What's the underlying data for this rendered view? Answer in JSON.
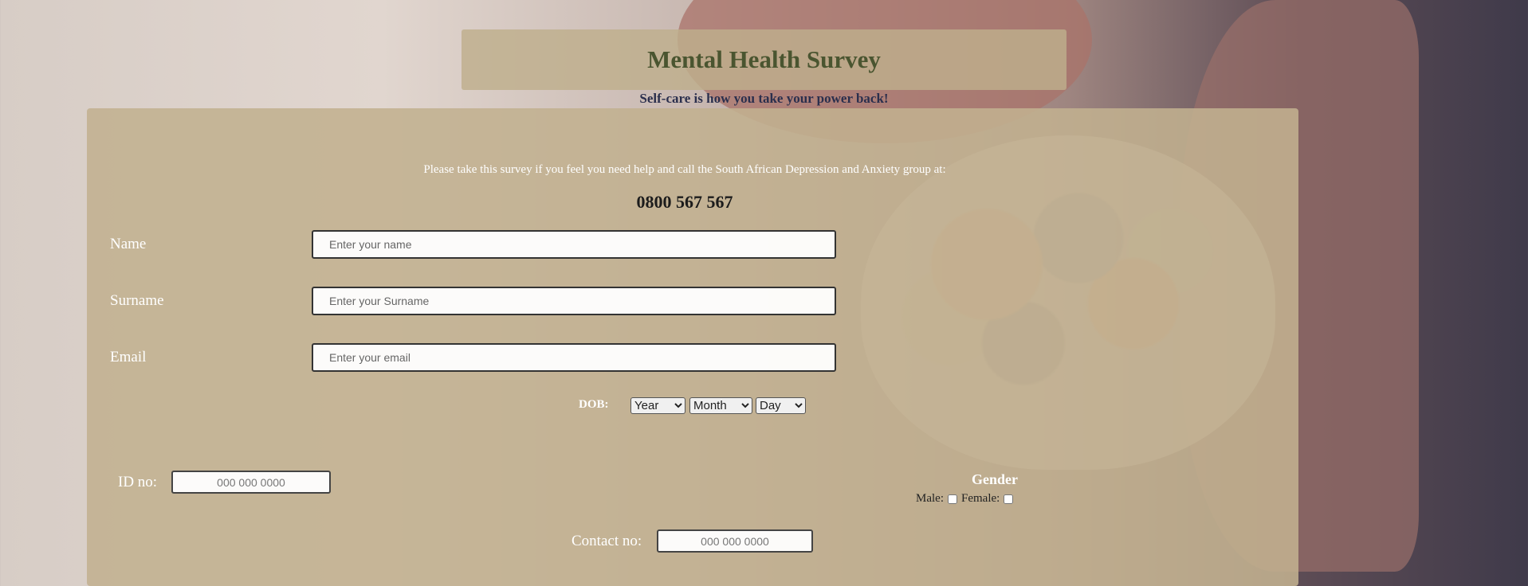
{
  "header": {
    "title": "Mental Health Survey",
    "tagline": "Self-care is how you take your power back!"
  },
  "intro": {
    "text": "Please take this survey if you feel you need help and call the South African Depression and Anxiety group at:",
    "phone": "0800 567 567"
  },
  "fields": {
    "name": {
      "label": "Name",
      "placeholder": "Enter your name"
    },
    "surname": {
      "label": "Surname",
      "placeholder": "Enter your Surname"
    },
    "email": {
      "label": "Email",
      "placeholder": "Enter your email"
    }
  },
  "dob": {
    "label": "DOB:",
    "year": "Year",
    "month": "Month",
    "day": "Day"
  },
  "id_no": {
    "label": "ID no:",
    "placeholder": "000 000 0000"
  },
  "gender": {
    "title": "Gender",
    "male": "Male:",
    "female": "Female:"
  },
  "contact": {
    "label": "Contact no:",
    "placeholder": "000 000 0000"
  },
  "colors": {
    "title_text": "#4a5530",
    "tagline_text": "#2b2f4d",
    "panel_bg": "#c1b08f"
  }
}
